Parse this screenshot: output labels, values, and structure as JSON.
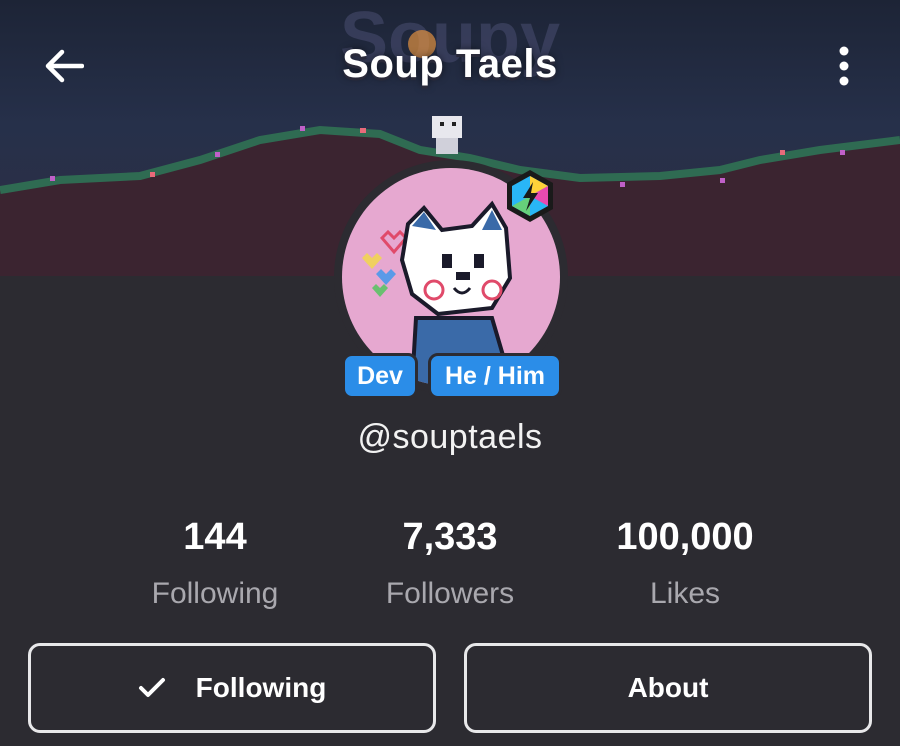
{
  "header": {
    "title": "Soup Taels",
    "banner_logo_text": "Soupy"
  },
  "profile": {
    "handle": "@souptaels",
    "tags": [
      "Dev",
      "He / Him"
    ]
  },
  "stats": [
    {
      "value": "144",
      "label": "Following"
    },
    {
      "value": "7,333",
      "label": "Followers"
    },
    {
      "value": "100,000",
      "label": "Likes"
    }
  ],
  "actions": {
    "following_label": "Following",
    "about_label": "About"
  },
  "colors": {
    "background": "#2c2b31",
    "tag": "#2b8de8",
    "avatar_bg": "#e6a8d0"
  }
}
